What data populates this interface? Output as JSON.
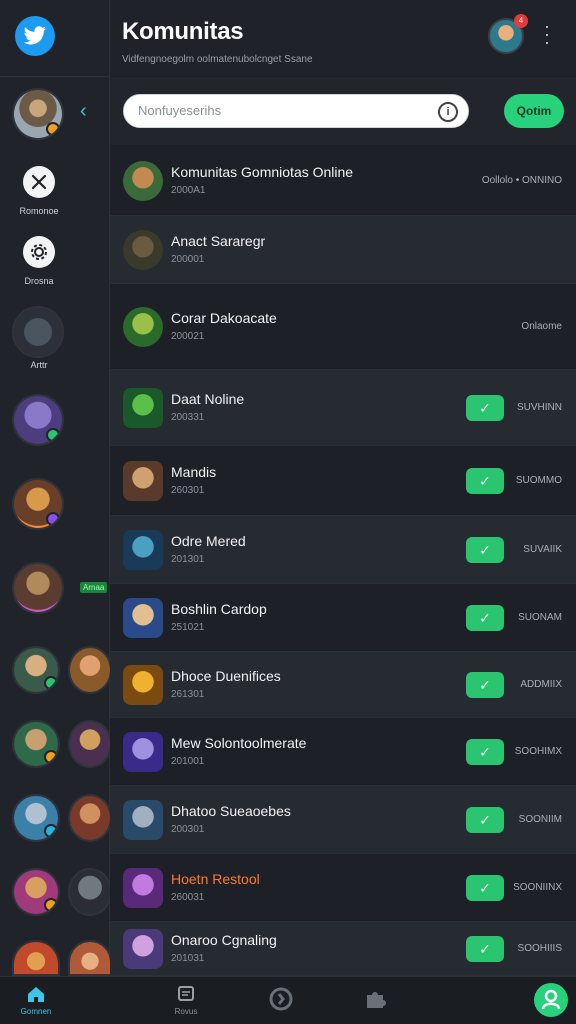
{
  "header": {
    "title": "Komunitas",
    "subtitle": "Vidfengnoegolm oolmatenubolcnget Ssane",
    "notification_count": "4"
  },
  "rail": {
    "tools": [
      {
        "label": "Romonoe",
        "icon": "crossed-tools-icon"
      },
      {
        "label": "Drosna",
        "icon": "gear-icon"
      }
    ],
    "featured_label": "Arttr",
    "live_tag": "Arnaa"
  },
  "search": {
    "placeholder": "Nonfuyeserihs",
    "button_label": "Qotim"
  },
  "communities": [
    {
      "name": "Komunitas Gomniotas Online",
      "meta": "2000A1",
      "status": "Oollolo • ONNINO",
      "checked": false
    },
    {
      "name": "Anact Sararegr",
      "meta": "200001",
      "status": "",
      "checked": false
    },
    {
      "name": "Corar Dakoacate",
      "meta": "200021",
      "status": "Onlaome",
      "checked": false
    },
    {
      "name": "Daat Noline",
      "meta": "200331",
      "status": "SUVHINN",
      "checked": true
    },
    {
      "name": "Mandis",
      "meta": "260301",
      "status": "SUOMMO",
      "checked": true
    },
    {
      "name": "Odre Mered",
      "meta": "201301",
      "status": "SUVAIIK",
      "checked": true
    },
    {
      "name": "Boshlin Cardop",
      "meta": "251021",
      "status": "SUONAM",
      "checked": true
    },
    {
      "name": "Dhoce Duenifices",
      "meta": "261301",
      "status": "ADDMIIX",
      "checked": true
    },
    {
      "name": "Mew Solontoolmerate",
      "meta": "201001",
      "status": "SOOHIMX",
      "checked": true
    },
    {
      "name": "Dhatoo Sueaoebes",
      "meta": "200301",
      "status": "SOONIIM",
      "checked": true
    },
    {
      "name": "Hoetn Restool",
      "meta": "260031",
      "status": "SOONIINX",
      "checked": true
    },
    {
      "name": "Onaroo Cgnaling",
      "meta": "201031",
      "status": "SOOHIIIS",
      "checked": true
    }
  ],
  "bottom_nav": {
    "home_label": "Gomnen",
    "inbox_label": "Rovus"
  },
  "colors": {
    "accent_green": "#28d17c",
    "brand_blue": "#1d9bf0",
    "background": "#1b1e24"
  }
}
